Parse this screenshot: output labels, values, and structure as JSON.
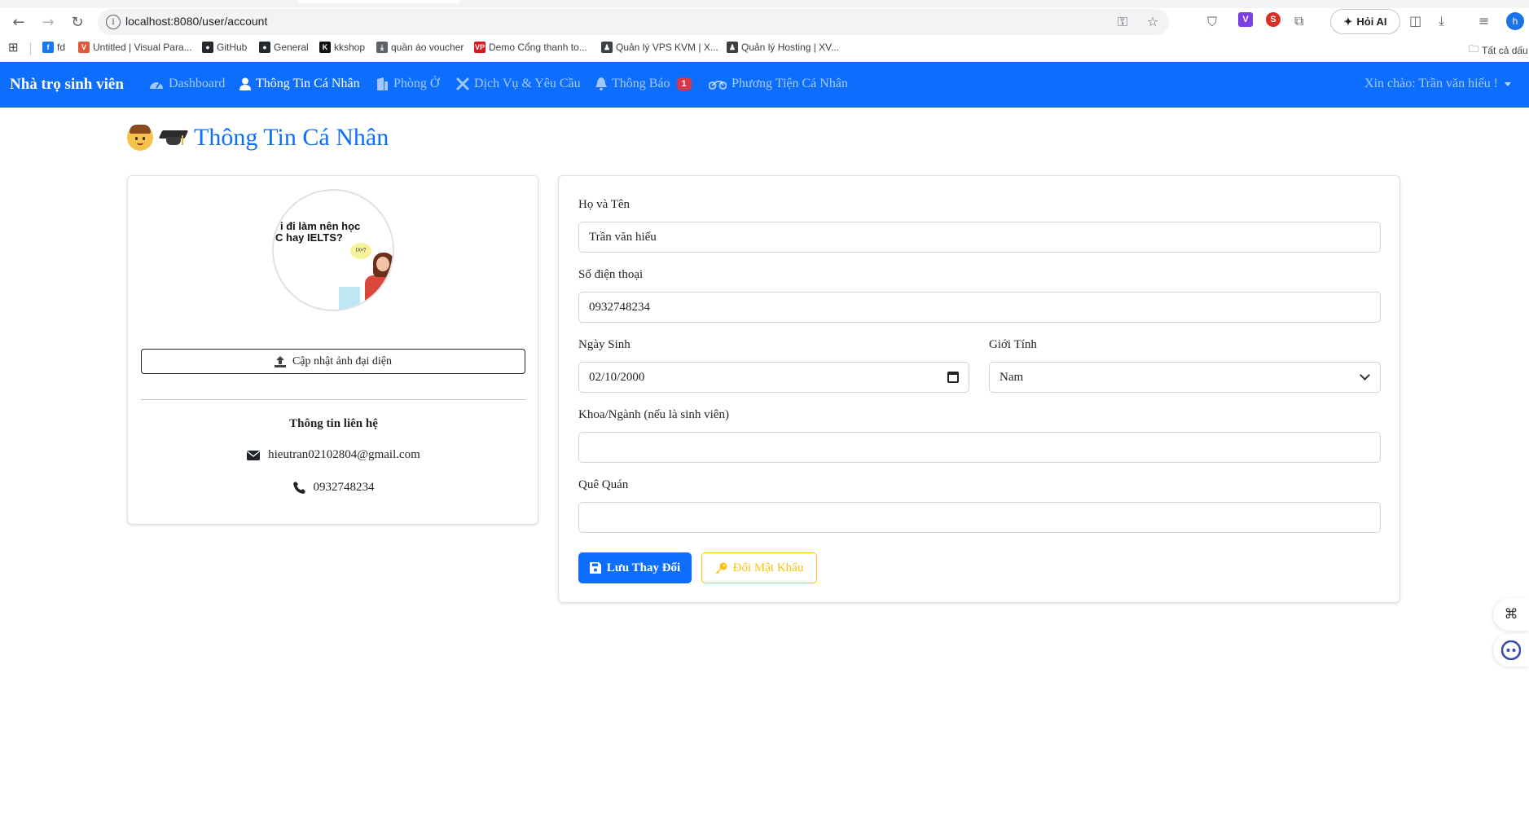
{
  "browser": {
    "url": "localhost:8080/user/account",
    "ask_ai_label": "Hỏi AI",
    "profile_initial": "h",
    "bookmarks": [
      {
        "label": "fd",
        "icon": "facebook-icon",
        "color": "#1877f2",
        "glyph": "f"
      },
      {
        "label": "Untitled | Visual Para...",
        "icon": "visual-paradigm-icon",
        "color": "#e05a3a",
        "glyph": "V"
      },
      {
        "label": "GitHub",
        "icon": "github-icon",
        "color": "#24292f",
        "glyph": "●"
      },
      {
        "label": "General",
        "icon": "github-icon",
        "color": "#24292f",
        "glyph": "●"
      },
      {
        "label": "kkshop",
        "icon": "kkshop-icon",
        "color": "#111111",
        "glyph": "K"
      },
      {
        "label": "quần áo voucher",
        "icon": "voucher-icon",
        "color": "#5f6368",
        "glyph": "⤓"
      },
      {
        "label": "Demo Cổng thanh to...",
        "icon": "vnpay-icon",
        "color": "#d71920",
        "glyph": "VP"
      },
      {
        "label": "Quản lý VPS KVM | X...",
        "icon": "user-icon",
        "color": "#3c4043",
        "glyph": "♟"
      },
      {
        "label": "Quản lý Hosting | XV...",
        "icon": "user-icon",
        "color": "#3c4043",
        "glyph": "♟"
      }
    ],
    "all_bookmarks_label": "Tất cả dấu"
  },
  "navbar": {
    "brand": "Nhà trọ sinh viên",
    "items": [
      {
        "label": "Dashboard",
        "icon": "dashboard-icon",
        "active": false
      },
      {
        "label": "Thông Tin Cá Nhân",
        "icon": "user-icon",
        "active": true
      },
      {
        "label": "Phòng Ở",
        "icon": "building-icon",
        "active": false
      },
      {
        "label": "Dịch Vụ & Yêu Cầu",
        "icon": "tools-icon",
        "active": false
      },
      {
        "label": "Thông Báo",
        "icon": "bell-icon",
        "active": false,
        "badge": "1"
      },
      {
        "label": "Phương Tiện Cá Nhân",
        "icon": "motorcycle-icon",
        "active": false
      }
    ],
    "greeting": "Xin chào: Trần văn hiếu !"
  },
  "page": {
    "title": "Thông Tin Cá Nhân"
  },
  "profile_card": {
    "avatar_text_line1": "i đi làm nên học",
    "avatar_text_line2": "C hay IELTS?",
    "avatar_bubble": "IX•?",
    "upload_button": "Cập nhật ảnh đại diện",
    "contact_title": "Thông tin liên hệ",
    "email": "hieutran02102804@gmail.com",
    "phone": "0932748234"
  },
  "form": {
    "fullname_label": "Họ và Tên",
    "fullname_value": "Trần văn hiếu",
    "phone_label": "Số điện thoại",
    "phone_value": "0932748234",
    "dob_label": "Ngày Sinh",
    "dob_value": "02/10/2000",
    "gender_label": "Giới Tính",
    "gender_value": "Nam",
    "faculty_label": "Khoa/Ngành (nếu là sinh viên)",
    "faculty_value": "",
    "hometown_label": "Quê Quán",
    "hometown_value": "",
    "save_button": "Lưu Thay Đổi",
    "change_password_button": "Đổi Mật Khẩu"
  },
  "colors": {
    "primary": "#0d6efd",
    "warning": "#ffc107",
    "danger": "#dc3545"
  }
}
